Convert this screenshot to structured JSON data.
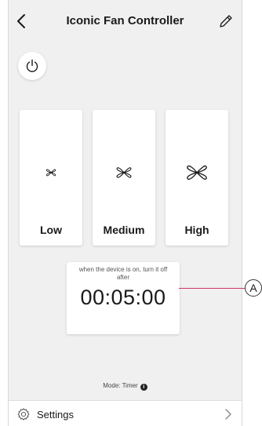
{
  "header": {
    "title": "Iconic Fan Controller"
  },
  "speeds": [
    {
      "label": "Low"
    },
    {
      "label": "Medium"
    },
    {
      "label": "High"
    }
  ],
  "timer": {
    "hint": "when the device is on, turn it off after",
    "value": "00:05:00"
  },
  "mode": {
    "text": "Mode: Timer"
  },
  "settings": {
    "label": "Settings"
  },
  "callout": {
    "label": "A",
    "color": "#cc3366"
  },
  "icons": {
    "back": "chevron-left-icon",
    "edit": "pencil-icon",
    "power": "power-icon",
    "fan": "fan-icon",
    "info": "info-icon",
    "gear": "gear-icon",
    "chevron": "chevron-right-icon"
  }
}
